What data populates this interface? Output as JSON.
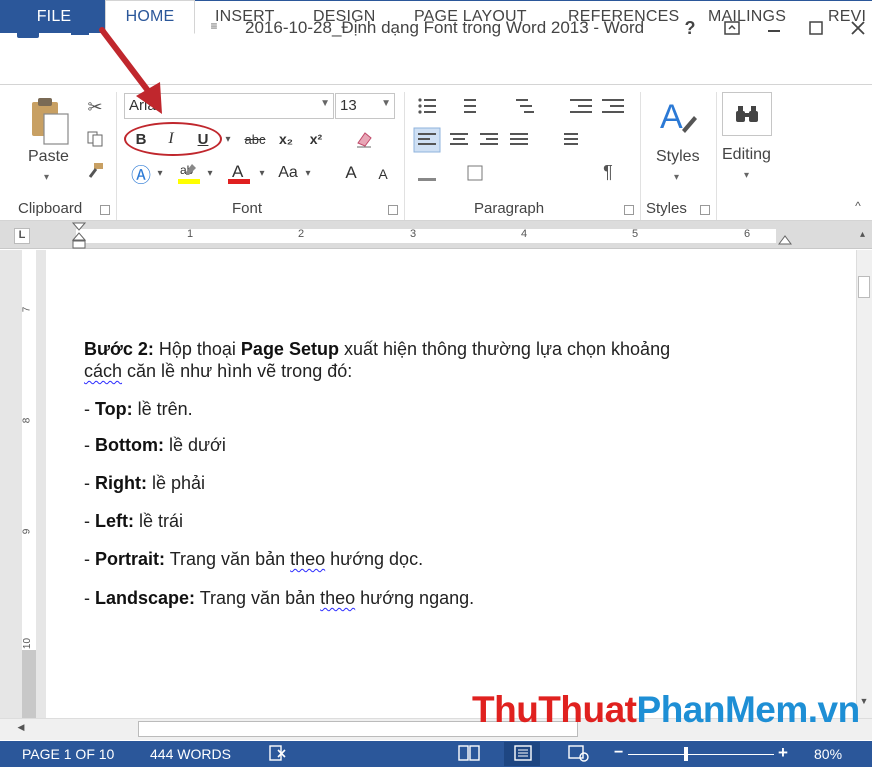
{
  "window": {
    "title": "2016-10-28_Định dạng Font trong Word 2013 - Word",
    "help": "?",
    "app_icon": "W"
  },
  "tabs": [
    "FILE",
    "HOME",
    "INSERT",
    "DESIGN",
    "PAGE LAYOUT",
    "REFERENCES",
    "MAILINGS",
    "REVI"
  ],
  "ribbon": {
    "clipboard": {
      "paste_label": "Paste",
      "group_label": "Clipboard"
    },
    "font": {
      "font_name": "Arial",
      "font_size": "13",
      "bold": "B",
      "italic": "I",
      "underline": "U",
      "strike": "abc",
      "subscript": "x₂",
      "superscript": "x²",
      "change_case": "Aa",
      "grow": "A",
      "shrink": "A",
      "group_label": "Font"
    },
    "paragraph": {
      "pilcrow": "¶",
      "group_label": "Paragraph"
    },
    "styles": {
      "label": "Styles",
      "group_label": "Styles"
    },
    "editing": {
      "label": "Editing"
    }
  },
  "ruler": {
    "marks": [
      "1",
      "2",
      "3",
      "4",
      "5",
      "6"
    ]
  },
  "vruler": {
    "marks": [
      "7",
      "8",
      "9",
      "10"
    ]
  },
  "document": {
    "p1_bold": "Bước 2:",
    "p1_a": " Hộp thoại ",
    "p1_bold2": "Page Setup",
    "p1_b": " xuất hiện thông thường lựa chọn khoảng",
    "p1_line2_squig": "cách",
    "p1_line2": " căn lề như hình vẽ trong đó:",
    "items": [
      {
        "prefix": "- ",
        "bold": "Top:",
        "text": " lề trên."
      },
      {
        "prefix": "- ",
        "bold": "Bottom:",
        "text": " lề dưới"
      },
      {
        "prefix": "- ",
        "bold": "Right:",
        "text": " lề phải"
      },
      {
        "prefix": "- ",
        "bold": "Left:",
        "text": " lề trái"
      }
    ],
    "portrait": {
      "prefix": "- ",
      "bold": "Portrait:",
      "a": " Trang văn bản ",
      "squig": "theo",
      "b": " hướng dọc."
    },
    "landscape": {
      "prefix": "- ",
      "bold": "Landscape:",
      "a": " Trang văn bản ",
      "squig": "theo",
      "b": " hướng ngang."
    }
  },
  "watermark": {
    "part1": "ThuThuat",
    "part2": "PhanMem.vn"
  },
  "status": {
    "page": "PAGE 1 OF 10",
    "words": "444 WORDS",
    "zoom": "80%"
  },
  "colors": {
    "accent": "#2b579a",
    "annotation": "#c0272d"
  }
}
